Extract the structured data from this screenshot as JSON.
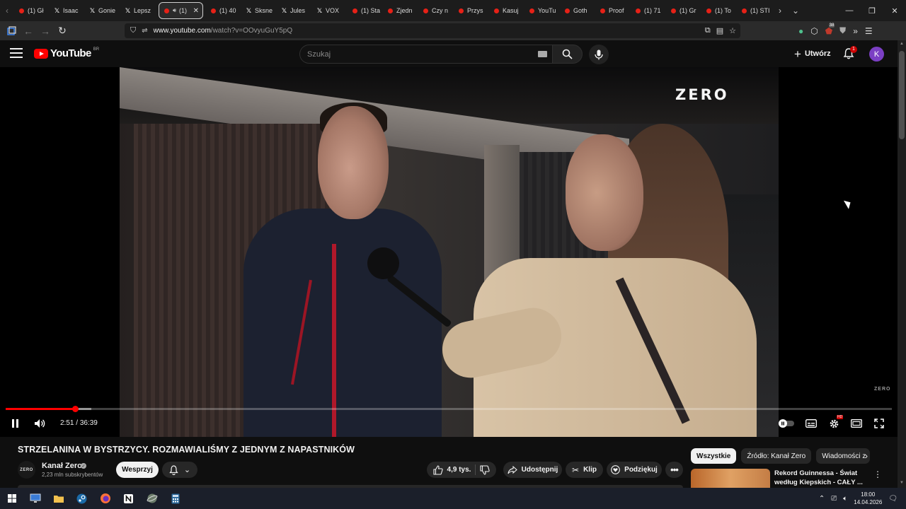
{
  "browser": {
    "tabs": [
      {
        "label": "(1) Gł",
        "favicon": "youtube-icon"
      },
      {
        "label": "Isaac",
        "favicon": "x-icon"
      },
      {
        "label": "Gonie",
        "favicon": "x-icon"
      },
      {
        "label": "Lepsz",
        "favicon": "x-icon"
      },
      {
        "label": "(1)",
        "favicon": "youtube-icon",
        "active": true,
        "audio": true
      },
      {
        "label": "(1) 40",
        "favicon": "youtube-icon"
      },
      {
        "label": "Sksne",
        "favicon": "x-icon"
      },
      {
        "label": "Jules",
        "favicon": "x-icon"
      },
      {
        "label": "VOX",
        "favicon": "x-icon"
      },
      {
        "label": "(1) Sta",
        "favicon": "youtube-icon"
      },
      {
        "label": "Zjedn",
        "favicon": "youtube-icon"
      },
      {
        "label": "Czy n",
        "favicon": "youtube-icon"
      },
      {
        "label": "Przys",
        "favicon": "youtube-icon"
      },
      {
        "label": "Kasuj",
        "favicon": "youtube-icon"
      },
      {
        "label": "YouTu",
        "favicon": "youtube-icon"
      },
      {
        "label": "Goth",
        "favicon": "youtube-icon"
      },
      {
        "label": "Proof",
        "favicon": "youtube-icon"
      },
      {
        "label": "(1) 71",
        "favicon": "youtube-icon"
      },
      {
        "label": "(1) Gr",
        "favicon": "youtube-icon"
      },
      {
        "label": "(1) To",
        "favicon": "youtube-icon"
      },
      {
        "label": "(1) STI",
        "favicon": "youtube-icon"
      }
    ],
    "url_host": "www.youtube.com",
    "url_path": "/watch?v=OOvyuGuY5pQ",
    "extension_badge": "38"
  },
  "header": {
    "logo_text": "YouTube",
    "region": "BR",
    "search_placeholder": "Szukaj",
    "create_label": "Utwórz",
    "notification_count": "1",
    "avatar_letter": "K"
  },
  "player": {
    "brand_overlay": "ZERO",
    "corner_watermark": "ZERO",
    "current_time": "2:51",
    "duration": "36:39",
    "progress_played": 0.078,
    "progress_buffered": 0.097,
    "hd_badge": "HD",
    "state": "playing"
  },
  "video": {
    "title": "STRZELANINA W BYSTRZYCY. ROZMAWIALIŚMY Z JEDNYM Z NAPASTNIKÓW",
    "channel_name": "Kanał Zero",
    "channel_avatar_text": "ZERO",
    "subscribers": "2,23 mln subskrybentów",
    "support_label": "Wesprzyj",
    "likes": "4,9 tys.",
    "share_label": "Udostępnij",
    "clip_label": "Klip",
    "thanks_label": "Podziękuj"
  },
  "sidebar": {
    "chips": [
      "Wszystkie",
      "Źródło: Kanał Zero",
      "Wiadomości z"
    ],
    "rec_title": "Rekord Guinnessa - Świat według Kiepskich - CAŁY ..."
  },
  "taskbar": {
    "time": "18:00",
    "date": "14.04.2026"
  }
}
